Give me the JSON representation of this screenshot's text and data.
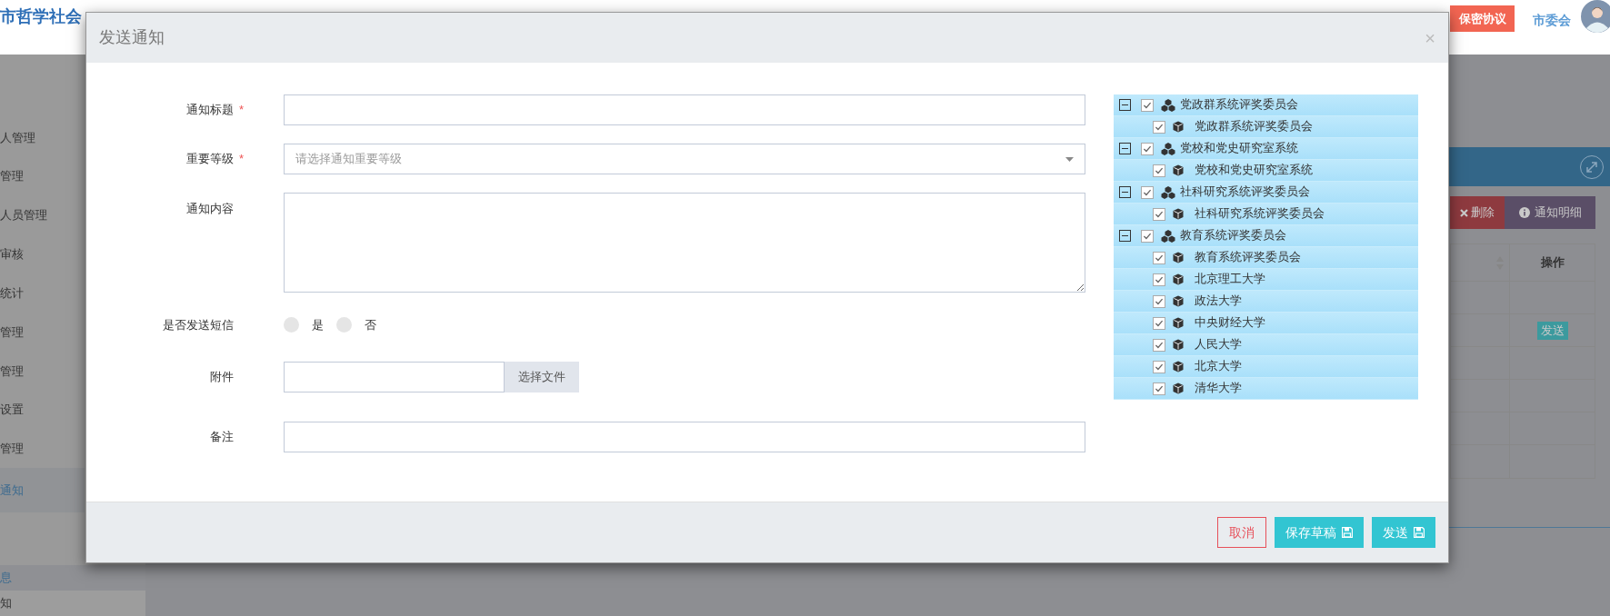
{
  "header": {
    "title": "市哲学社会",
    "agreement_button": "保密协议",
    "user_name": "市委会"
  },
  "sidebar": {
    "items": [
      {
        "label": "人管理",
        "selected": false
      },
      {
        "label": "管理",
        "selected": false
      },
      {
        "label": "人员管理",
        "selected": false
      },
      {
        "label": "审核",
        "selected": false
      },
      {
        "label": "统计",
        "selected": false
      },
      {
        "label": "管理",
        "selected": false
      },
      {
        "label": "管理",
        "selected": false
      },
      {
        "label": "设置",
        "selected": false
      },
      {
        "label": "管理",
        "selected": false
      },
      {
        "label": "通知",
        "selected": true
      }
    ],
    "sub_items": [
      {
        "label": "息",
        "selected": true
      },
      {
        "label": "知",
        "selected": false
      }
    ]
  },
  "background": {
    "actions": [
      {
        "kind": "delete",
        "label": "删除"
      },
      {
        "kind": "detail",
        "label": "通知明细"
      }
    ],
    "operation_column": "操作",
    "rows": [
      {
        "send": false
      },
      {
        "send": true
      },
      {
        "send": false
      },
      {
        "send": false
      },
      {
        "send": false
      },
      {
        "send": false
      }
    ],
    "send_label": "发送"
  },
  "modal": {
    "title": "发送通知",
    "close": "×",
    "required_mark": "*",
    "fields": [
      {
        "kind": "text",
        "label": "通知标题",
        "required": true
      },
      {
        "kind": "select",
        "label": "重要等级",
        "required": true,
        "placeholder": "请选择通知重要等级"
      },
      {
        "kind": "textarea",
        "label": "通知内容",
        "required": false
      },
      {
        "kind": "radio",
        "label": "是否发送短信",
        "required": false,
        "options": [
          {
            "label": "是",
            "selected": false
          },
          {
            "label": "否",
            "selected": false
          }
        ]
      },
      {
        "kind": "file",
        "label": "附件",
        "required": false,
        "button": "选择文件"
      },
      {
        "kind": "text",
        "label": "备注",
        "required": false
      }
    ],
    "tree": [
      {
        "label": "党政群系统评奖委员会",
        "expanded": true,
        "checked": true,
        "children": [
          {
            "label": "党政群系统评奖委员会",
            "checked": true
          }
        ]
      },
      {
        "label": "党校和党史研究室系统",
        "expanded": true,
        "checked": true,
        "children": [
          {
            "label": "党校和党史研究室系统",
            "checked": true
          }
        ]
      },
      {
        "label": "社科研究系统评奖委员会",
        "expanded": true,
        "checked": true,
        "children": [
          {
            "label": "社科研究系统评奖委员会",
            "checked": true
          }
        ]
      },
      {
        "label": "教育系统评奖委员会",
        "expanded": true,
        "checked": true,
        "children": [
          {
            "label": "教育系统评奖委员会",
            "checked": true
          },
          {
            "label": "北京理工大学",
            "checked": true
          },
          {
            "label": "政法大学",
            "checked": true
          },
          {
            "label": "中央财经大学",
            "checked": true
          },
          {
            "label": "人民大学",
            "checked": true
          },
          {
            "label": "北京大学",
            "checked": true
          },
          {
            "label": "清华大学",
            "checked": true
          }
        ]
      }
    ],
    "buttons": [
      {
        "kind": "cancel",
        "label": "取消"
      },
      {
        "kind": "save",
        "label": "保存草稿"
      },
      {
        "kind": "send",
        "label": "发送"
      }
    ]
  }
}
